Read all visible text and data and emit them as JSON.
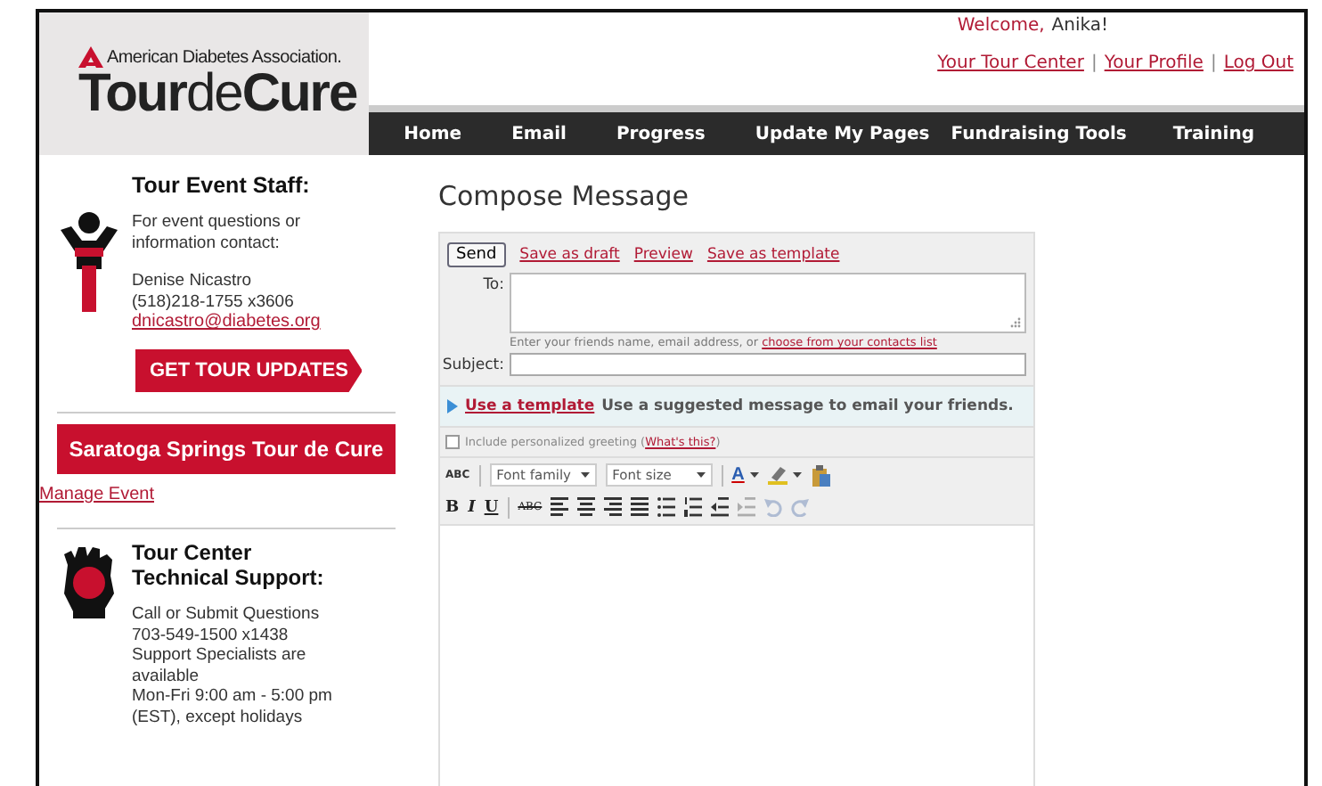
{
  "header": {
    "logo": {
      "org": "American Diabetes Association.",
      "brand": [
        "Tour",
        "de",
        "Cure"
      ]
    },
    "welcome": {
      "greeting": "Welcome,",
      "name": "Anika!"
    },
    "user_links": [
      {
        "kind": "link",
        "label": "Your Tour Center"
      },
      {
        "kind": "separator",
        "label": "|"
      },
      {
        "kind": "link",
        "label": "Your Profile"
      },
      {
        "kind": "separator",
        "label": "|"
      },
      {
        "kind": "link",
        "label": "Log Out"
      }
    ]
  },
  "nav": [
    {
      "label": "Home"
    },
    {
      "label": "Email"
    },
    {
      "label": "Progress"
    },
    {
      "label": "Update My Pages"
    },
    {
      "label": "Fundraising Tools"
    },
    {
      "label": "Training"
    }
  ],
  "sidebar": {
    "staff": {
      "title": "Tour Event Staff:",
      "intro": "For event questions or information contact:",
      "name": "Denise Nicastro",
      "phone": "(518)218-1755 x3606",
      "email": "dnicastro@diabetes.org"
    },
    "updates_button": "GET TOUR UPDATES",
    "event_banner": "Saratoga Springs Tour de Cure",
    "manage_link": "Manage Event",
    "support": {
      "title": "Tour Center Technical Support:",
      "lines": [
        "Call or Submit Questions",
        "703-549-1500 x1438",
        "Support Specialists are available",
        "Mon-Fri 9:00 am - 5:00 pm (EST), except holidays"
      ]
    }
  },
  "compose": {
    "title": "Compose Message",
    "send": "Send",
    "links": [
      "Save as draft",
      "Preview",
      "Save as template"
    ],
    "to": {
      "label": "To:",
      "hint": "Enter your friends name, email address, or ",
      "hint_link": "choose from your contacts list"
    },
    "subject": {
      "label": "Subject:"
    },
    "template": {
      "link": "Use a template",
      "text": "Use a suggested message to email your friends."
    },
    "greeting": {
      "label": "Include personalized greeting (",
      "link": "What's this?",
      "after": ")",
      "checked": false
    },
    "toolbar_1": [
      {
        "kind": "spell",
        "label": "ABC"
      },
      {
        "kind": "sep"
      },
      {
        "kind": "select",
        "label": "Font family"
      },
      {
        "kind": "select",
        "label": "Font size"
      },
      {
        "kind": "sep"
      },
      {
        "kind": "color",
        "label": "A"
      },
      {
        "kind": "highlight"
      },
      {
        "kind": "paste"
      }
    ],
    "toolbar_2": [
      {
        "kind": "bold",
        "label": "B",
        "disabled": false
      },
      {
        "kind": "italic",
        "label": "I",
        "disabled": false
      },
      {
        "kind": "underline",
        "label": "U",
        "disabled": false
      },
      {
        "kind": "sep"
      },
      {
        "kind": "strike",
        "label": "ABC",
        "disabled": false
      },
      {
        "kind": "align_left",
        "disabled": false
      },
      {
        "kind": "align_center",
        "disabled": false
      },
      {
        "kind": "align_right",
        "disabled": false
      },
      {
        "kind": "align_justify",
        "disabled": false
      },
      {
        "kind": "bullets",
        "disabled": false
      },
      {
        "kind": "numbers",
        "disabled": false
      },
      {
        "kind": "outdent",
        "disabled": false
      },
      {
        "kind": "indent",
        "disabled": true
      },
      {
        "kind": "undo",
        "disabled": true
      },
      {
        "kind": "redo",
        "disabled": true
      }
    ]
  }
}
